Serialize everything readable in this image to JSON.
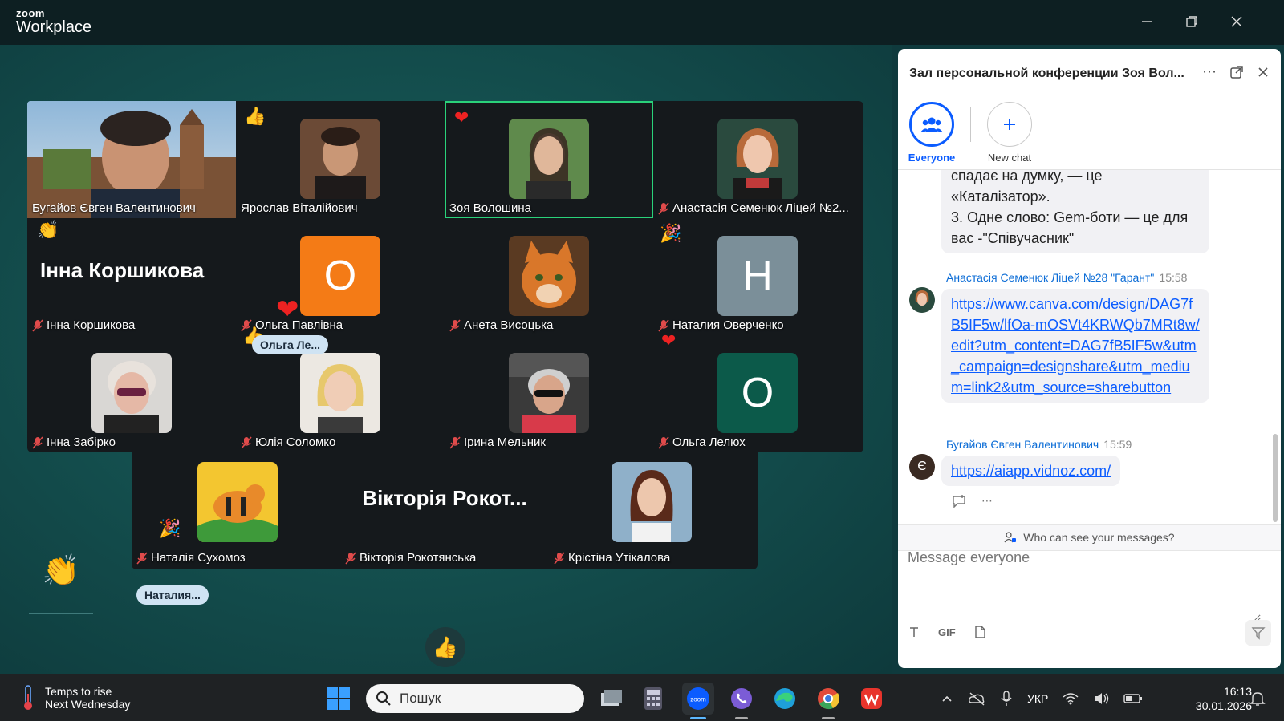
{
  "app": {
    "logo_line1": "zoom",
    "logo_line2": "Workplace"
  },
  "participants": [
    {
      "name": "Бугайов Євген Валентинович",
      "muted": false,
      "view": "video"
    },
    {
      "name": "Ярослав Віталійович",
      "muted": false,
      "view": "photo",
      "reaction": "thumbs-up"
    },
    {
      "name": "Зоя Волошина",
      "muted": false,
      "view": "photo",
      "reaction": "heart",
      "active_speaker": true
    },
    {
      "name": "Анастасія Семенюк Ліцей №2...",
      "muted": true,
      "view": "photo"
    },
    {
      "name": "Інна Коршикова",
      "display_big": "Інна Коршикова",
      "muted": true,
      "view": "name",
      "reaction": "clap"
    },
    {
      "name": "Ольга Павлівна",
      "muted": true,
      "view": "letter",
      "letter": "O",
      "reaction": "heart"
    },
    {
      "name": "Анета Висоцька",
      "muted": true,
      "view": "photo"
    },
    {
      "name": "Наталия Оверченко",
      "muted": true,
      "view": "letter",
      "letter": "Н",
      "reaction": "party"
    },
    {
      "name": "Інна Забірко",
      "muted": true,
      "view": "photo"
    },
    {
      "name": "Юлія Соломко",
      "muted": true,
      "view": "photo",
      "reaction": "thumbs-up"
    },
    {
      "name": "Ірина Мельник",
      "muted": true,
      "view": "photo"
    },
    {
      "name": "Ольга Лелюх",
      "muted": true,
      "view": "letter",
      "letter": "O",
      "reaction": "heart"
    },
    {
      "name": "Наталія Сухомоз",
      "muted": true,
      "view": "photo",
      "reaction": "party"
    },
    {
      "name": "Вікторія Рокотянська",
      "display_big": "Вікторія Рокот...",
      "muted": true,
      "view": "name"
    },
    {
      "name": "Крістіна Утікалова",
      "muted": true,
      "view": "photo"
    }
  ],
  "floating_chips": {
    "olga_chip": "Ольга Ле...",
    "natalia_chip": "Наталия..."
  },
  "colors": {
    "accent": "#0b5cff",
    "active_speaker": "#2ad27a",
    "letter_orange": "#f47b16",
    "letter_gray": "#7b8f99",
    "letter_green": "#0c5a4a"
  },
  "chat": {
    "title": "Зал персональной конференции Зоя Вол...",
    "tabs": [
      {
        "label": "Everyone",
        "selected": true
      },
      {
        "label": "New chat",
        "selected": false
      }
    ],
    "partial_message": "спадає на думку, — це «Каталізатор».\n3. Одне слово: Gem-боти — це для вас -\"Співучасник\"",
    "messages": [
      {
        "sender": "Анастасія Семенюк Ліцей №28 \"Гарант\"",
        "time": "15:58",
        "text": "https://www.canva.com/design/DAG7fB5IF5w/lfOa-mOSVt4KRWQb7MRt8w/edit?utm_content=DAG7fB5IF5w&utm_campaign=designshare&utm_medium=link2&utm_source=sharebutton"
      },
      {
        "sender": "Бугайов Євген Валентинович",
        "time": "15:59",
        "avatar_letter": "Є",
        "text": "https://aiapp.vidnoz.com/"
      }
    ],
    "who_can_see": "Who can see your messages?",
    "input_placeholder": "Message everyone",
    "tool_gif": "GIF"
  },
  "taskbar": {
    "weather_line1": "Temps to rise",
    "weather_line2": "Next Wednesday",
    "search_placeholder": "Пошук",
    "language": "УКР",
    "time": "16:13",
    "date": "30.01.2026"
  }
}
